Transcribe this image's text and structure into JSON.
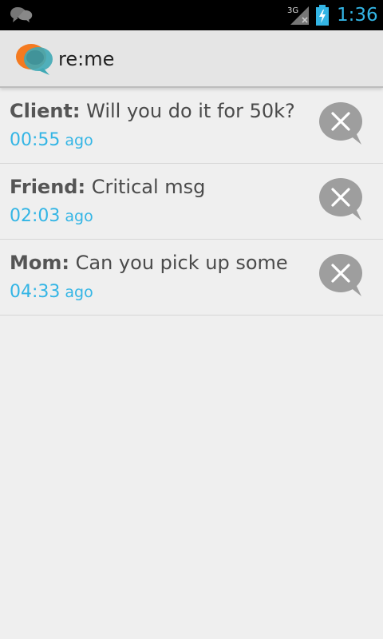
{
  "status_bar": {
    "time": "1:36",
    "network_label": "3G",
    "icons": [
      "chat-notification-icon",
      "signal-3g-icon",
      "battery-charging-icon"
    ]
  },
  "app": {
    "title": "re:me",
    "logo_icon": "reme-logo-icon"
  },
  "messages": [
    {
      "sender": "Client:",
      "text": "Will you do it for 50k?",
      "time": "00:55",
      "suffix": "ago"
    },
    {
      "sender": "Friend:",
      "text": " Critical msg",
      "time": "02:03",
      "suffix": "ago"
    },
    {
      "sender": "Mom:",
      "text": "Can you pick up some",
      "time": "04:33",
      "suffix": "ago"
    }
  ],
  "colors": {
    "accent": "#33b5e5",
    "background": "#efefef",
    "action_bar": "#e5e5e5",
    "dismiss_button": "#9e9e9e",
    "logo_orange": "#f47a20",
    "logo_teal": "#3fa9b5"
  }
}
